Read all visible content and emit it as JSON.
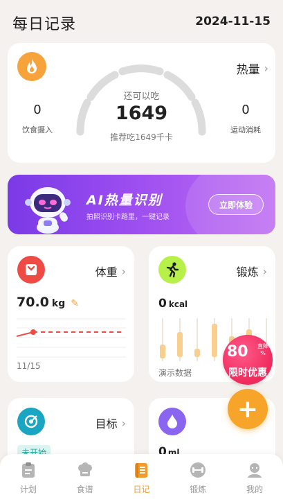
{
  "header": {
    "title": "每日记录",
    "date": "2024-11-15"
  },
  "calories": {
    "link_label": "热量",
    "remaining_label": "还可以吃",
    "remaining_value": "1649",
    "recommendation": "推荐吃1649千卡",
    "intake_value": "0",
    "intake_label": "饮食摄入",
    "burn_value": "0",
    "burn_label": "运动消耗",
    "flame_icon": "flame-icon",
    "accent_color": "#f5a33a"
  },
  "ai_banner": {
    "title": "AI热量识别",
    "subtitle": "拍照识别卡路里，一键记录",
    "button_label": "立即体验",
    "colors": [
      "#7a3ae6",
      "#c06ef2"
    ]
  },
  "weight": {
    "link_label": "体重",
    "value": "70.0",
    "unit": "kg",
    "date": "11/15",
    "icon": "scale-icon",
    "color": "#ef4b45"
  },
  "exercise": {
    "link_label": "锻炼",
    "value": "0",
    "unit": "kcal",
    "demo_label": "演示数据",
    "icon": "running-icon",
    "color": "#b8f04a"
  },
  "promo": {
    "percent": "80",
    "symbol": "%",
    "small": "直降",
    "label": "限时优惠"
  },
  "goal": {
    "link_label": "目标",
    "status": "未开始",
    "icon": "target-icon",
    "color": "#1aa5c2"
  },
  "water": {
    "value": "0",
    "unit": "ml",
    "icon": "water-drop-icon",
    "color": "#8a66f0"
  },
  "tabbar": {
    "tabs": [
      {
        "label": "计划",
        "icon": "clipboard-icon"
      },
      {
        "label": "食谱",
        "icon": "chef-hat-icon"
      },
      {
        "label": "日记",
        "icon": "diary-icon"
      },
      {
        "label": "锻炼",
        "icon": "dumbbell-icon"
      },
      {
        "label": "我的",
        "icon": "user-icon"
      }
    ],
    "active": "日记",
    "active_color": "#f49a2a"
  }
}
